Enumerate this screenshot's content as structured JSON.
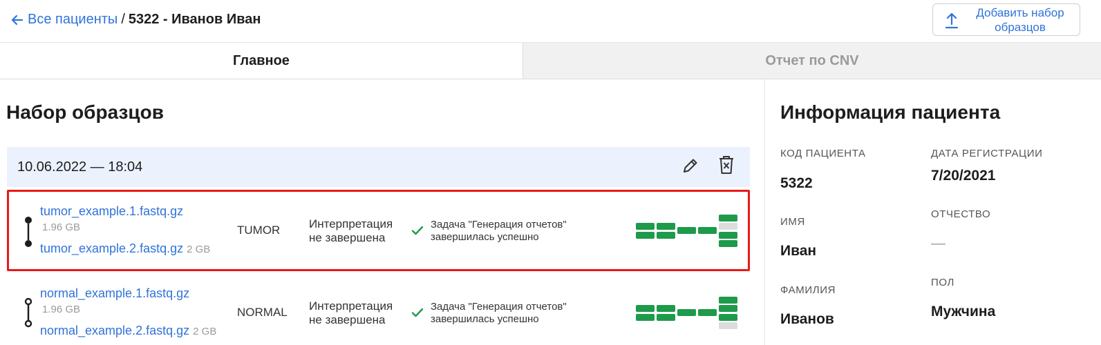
{
  "breadcrumb": {
    "back_label": "Все пациенты",
    "separator": "/",
    "current": "5322 - Иванов Иван"
  },
  "actions": {
    "add_sample_set": "Добавить набор образцов"
  },
  "tabs": [
    {
      "label": "Главное",
      "active": true
    },
    {
      "label": "Отчет по CNV",
      "active": false
    }
  ],
  "sample_sets": {
    "title": "Набор образцов",
    "sets": [
      {
        "datetime": "10.06.2022 — 18:04",
        "samples": [
          {
            "file1": "tumor_example.1.fastq.gz",
            "file1_size": "1.96 GB",
            "file2": "tumor_example.2.fastq.gz",
            "file2_size": "2 GB",
            "type": "TUMOR",
            "interpretation": [
              "Интерпретация",
              "не завершена"
            ],
            "task": [
              "Задача \"Генерация отчетов\"",
              "завершилась успешно"
            ],
            "highlighted": true
          },
          {
            "file1": "normal_example.1.fastq.gz",
            "file1_size": "1.96 GB",
            "file2": "normal_example.2.fastq.gz",
            "file2_size": "2 GB",
            "type": "NORMAL",
            "interpretation": [
              "Интерпретация",
              "не завершена"
            ],
            "task": [
              "Задача \"Генерация отчетов\"",
              "завершилась успешно"
            ],
            "highlighted": false
          }
        ]
      }
    ]
  },
  "patient_info": {
    "title": "Информация пациента",
    "fields": {
      "code_label": "КОД ПАЦИЕНТА",
      "code_value": "5322",
      "reg_label": "ДАТА РЕГИСТРАЦИИ",
      "reg_value": "7/20/2021",
      "name_label": "ИМЯ",
      "name_value": "Иван",
      "patronymic_label": "ОТЧЕСТВО",
      "patronymic_value": "—",
      "surname_label": "ФАМИЛИЯ",
      "surname_value": "Иванов",
      "sex_label": "ПОЛ",
      "sex_value": "Мужчина"
    }
  },
  "colors": {
    "accent": "#2f73d9",
    "success": "#1e9a4b",
    "highlight_border": "#e81818",
    "pending": "#dcdcdc"
  }
}
